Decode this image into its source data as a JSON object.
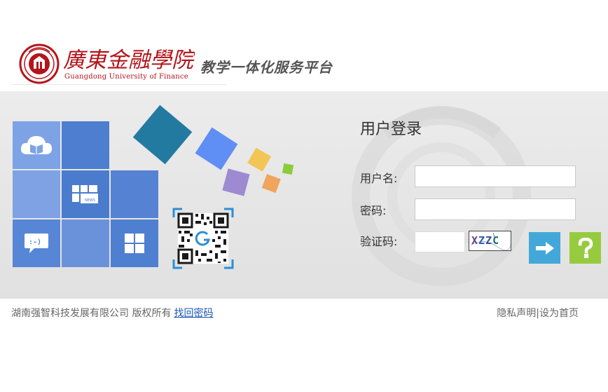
{
  "header": {
    "logo_script_text": "廣東金融學院",
    "logo_en": "Guangdong University of Finance",
    "platform_title": "教学一体化服务平台",
    "brand_color": "#b4141b"
  },
  "banner": {
    "tiles": [
      {
        "icon": "cloud-book-icon",
        "color": "#7da3e6"
      },
      {
        "icon": "none",
        "color": "#4d7ed0"
      },
      {
        "icon": "none",
        "color": "#7ea2e3"
      },
      {
        "icon": "news-icon",
        "color": "#4a7bcd",
        "text": "NEWS"
      },
      {
        "icon": "none",
        "color": "#5582d2"
      },
      {
        "icon": "chat-bubble-icon",
        "color": "#5786d6",
        "text": ":-)"
      },
      {
        "icon": "none",
        "color": "#6a92da"
      },
      {
        "icon": "grid-icon",
        "color": "#4f7fd1"
      }
    ],
    "qr_code": "qr-code-icon"
  },
  "login": {
    "title": "用户登录",
    "username_label": "用户名:",
    "username_value": "",
    "password_label": "密码:",
    "password_value": "",
    "captcha_label": "验证码:",
    "captcha_value": "",
    "captcha_image_text": "XZZC",
    "submit_icon": "arrow-right-icon",
    "submit_color": "#43a8d9",
    "help_icon": "question-mark-icon",
    "help_color": "#97cb3f"
  },
  "footer": {
    "copyright": "湖南强智科技发展有限公司 版权所有",
    "recover_password": "找回密码",
    "privacy": "隐私声明",
    "separator": "|",
    "set_homepage": "设为首页"
  }
}
